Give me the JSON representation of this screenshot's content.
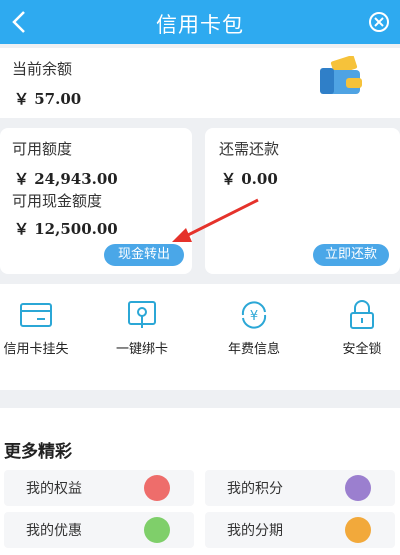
{
  "header": {
    "title": "信用卡包"
  },
  "balance": {
    "label": "当前余额",
    "amount": "￥ 57.00"
  },
  "credit": {
    "limit_label": "可用额度",
    "limit_amount": "￥ 24,943.00",
    "cash_label": "可用现金额度",
    "cash_amount": "￥ 12,500.00",
    "cash_out_button": "现金转出"
  },
  "repay": {
    "label": "还需还款",
    "amount": "￥ 0.00",
    "button": "立即还款"
  },
  "actions": [
    {
      "label": "信用卡挂失",
      "icon": "card-icon"
    },
    {
      "label": "一键绑卡",
      "icon": "phone-tap-icon"
    },
    {
      "label": "年费信息",
      "icon": "yen-cycle-icon"
    },
    {
      "label": "安全锁",
      "icon": "lock-icon"
    }
  ],
  "more": {
    "title": "更多精彩",
    "items": [
      {
        "label": "我的权益",
        "color": "#ee6d6b"
      },
      {
        "label": "我的积分",
        "color": "#9b7fcf"
      },
      {
        "label": "我的优惠",
        "color": "#7fcf6a"
      },
      {
        "label": "我的分期",
        "color": "#f2a93b"
      }
    ]
  },
  "colors": {
    "accent": "#2eaaf0",
    "button": "#4aa7e8",
    "arrow": "#e5322b"
  }
}
